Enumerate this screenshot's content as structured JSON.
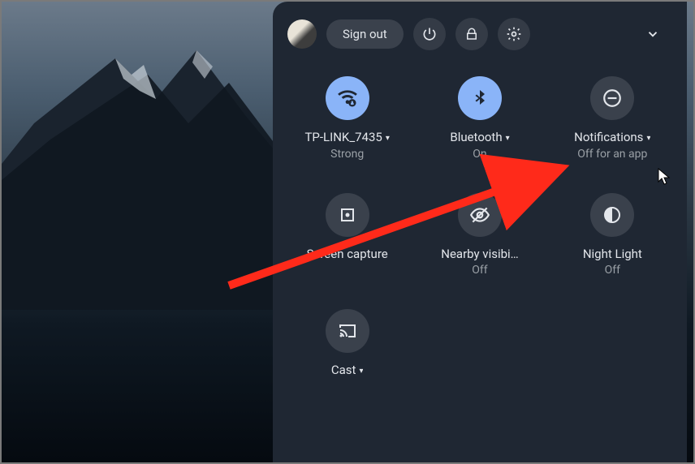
{
  "header": {
    "sign_out": "Sign out"
  },
  "tiles": {
    "wifi": {
      "label": "TP-LINK_7435",
      "sub": "Strong",
      "has_caret": true
    },
    "bluetooth": {
      "label": "Bluetooth",
      "sub": "On",
      "has_caret": true
    },
    "notifications": {
      "label": "Notifications",
      "sub": "Off for an app",
      "has_caret": true
    },
    "capture": {
      "label": "Screen capture",
      "sub": ""
    },
    "nearby": {
      "label": "Nearby visibi…",
      "sub": "Off"
    },
    "nightlight": {
      "label": "Night Light",
      "sub": "Off"
    },
    "cast": {
      "label": "Cast",
      "sub": "",
      "has_caret": true
    }
  },
  "annotation": {
    "arrow_color": "#ff2a1a"
  }
}
